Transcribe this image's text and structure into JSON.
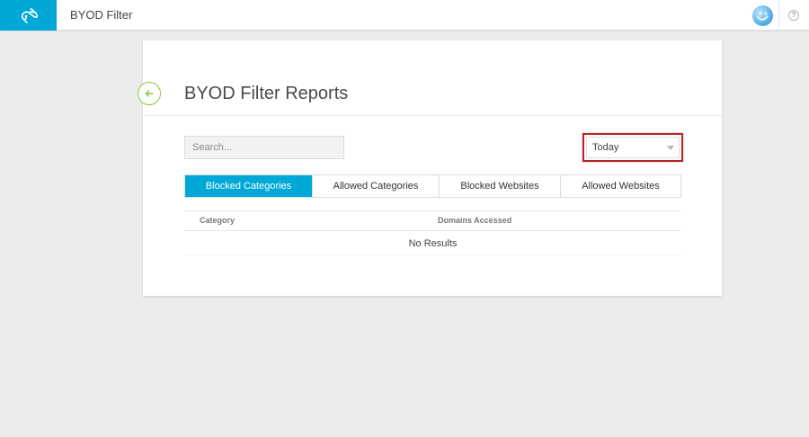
{
  "header": {
    "app_title": "BYOD Filter",
    "brand_color": "#00a8d8",
    "logo_icon": "infinity-swirl-icon",
    "avatar_icon": "smiley-avatar-icon",
    "help_icon": "question-mark-icon",
    "help_glyph": "?"
  },
  "page": {
    "title": "BYOD Filter Reports",
    "back_icon": "arrow-left-icon",
    "accent_back_color": "#8cc63f"
  },
  "filters": {
    "search_placeholder": "Search...",
    "search_value": "",
    "date_range": {
      "selected": "Today",
      "highlight_color": "#b5262a"
    }
  },
  "tabs": [
    {
      "label": "Blocked Categories",
      "active": true
    },
    {
      "label": "Allowed Categories",
      "active": false
    },
    {
      "label": "Blocked Websites",
      "active": false
    },
    {
      "label": "Allowed Websites",
      "active": false
    }
  ],
  "table": {
    "columns": [
      "Category",
      "Domains Accessed"
    ],
    "rows": [],
    "empty_text": "No Results"
  }
}
